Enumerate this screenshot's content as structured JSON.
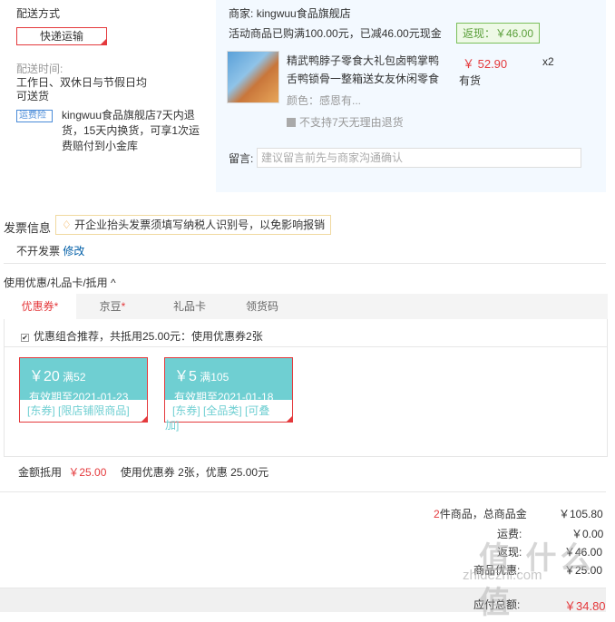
{
  "shipping": {
    "title": "配送方式",
    "method_button": "快递运输",
    "time_label": "配送时间:",
    "time_value_line1": "工作日、双休日与节假日均",
    "time_value_line2": "可送货",
    "insurance_badge": "运费险",
    "return_line1": "kingwuu食品旗舰店7天内退",
    "return_line2": "货，15天内换货，可享1次运",
    "return_line3": "费赔付到小金库"
  },
  "shop": {
    "seller_label": "商家:",
    "seller_name": "kingwuu食品旗舰店",
    "promo_text": "活动商品已购满100.00元，已减46.00元现金",
    "cashback": "返现：￥46.00",
    "product_title_line1": "精武鸭脖子零食大礼包卤鸭掌鸭",
    "product_title_line2": "舌鸭锁骨一整箱送女友休闲零食",
    "price": "￥ 52.90",
    "qty": "x2",
    "stock": "有货",
    "color_label": "颜色：感恩有...",
    "no_return_text": "不支持7天无理由退货",
    "message_label": "留言:",
    "message_placeholder": "建议留言前先与商家沟通确认"
  },
  "invoice": {
    "title": "发票信息",
    "tip": "开企业抬头发票须填写纳税人识别号，以免影响报销",
    "status": "不开发票",
    "edit_link": "修改"
  },
  "discount": {
    "section_title": "使用优惠/礼品卡/抵用",
    "tabs": [
      {
        "label": "优惠券",
        "star": "*"
      },
      {
        "label": "京豆",
        "star": "*"
      },
      {
        "label": "礼品卡",
        "star": ""
      },
      {
        "label": "领货码",
        "star": ""
      }
    ],
    "combo_text": "优惠组合推荐，共抵用25.00元：使用优惠券2张",
    "coupons": [
      {
        "amount": "￥20",
        "condition": "满52",
        "expiry": "有效期至2021-01-23",
        "tags_line1": "[东券] [限店铺限商品]",
        "tags_line2": ""
      },
      {
        "amount": "￥5",
        "condition": "满105",
        "expiry": "有效期至2021-01-18",
        "tags_line1": "[东券] [全品类] [可叠",
        "tags_line2": "加]"
      }
    ],
    "deduct_label": "金额抵用",
    "deduct_amount": "￥25.00",
    "deduct_desc": "使用优惠券 2张，优惠 25.00元"
  },
  "summary": {
    "count": "2",
    "count_text": "件商品，总商品金",
    "total_goods": "￥105.80",
    "shipping_label": "运费:",
    "shipping_value": "￥0.00",
    "cashback_label": "返现:",
    "cashback_value": "￥46.00",
    "coupon_label": "商品优惠:",
    "coupon_value": "￥25.00",
    "payable_label": "应付总额:",
    "payable_value": "￥34.80"
  },
  "watermark": {
    "big": "值 什么值",
    "small": "zhidezhi.com"
  }
}
